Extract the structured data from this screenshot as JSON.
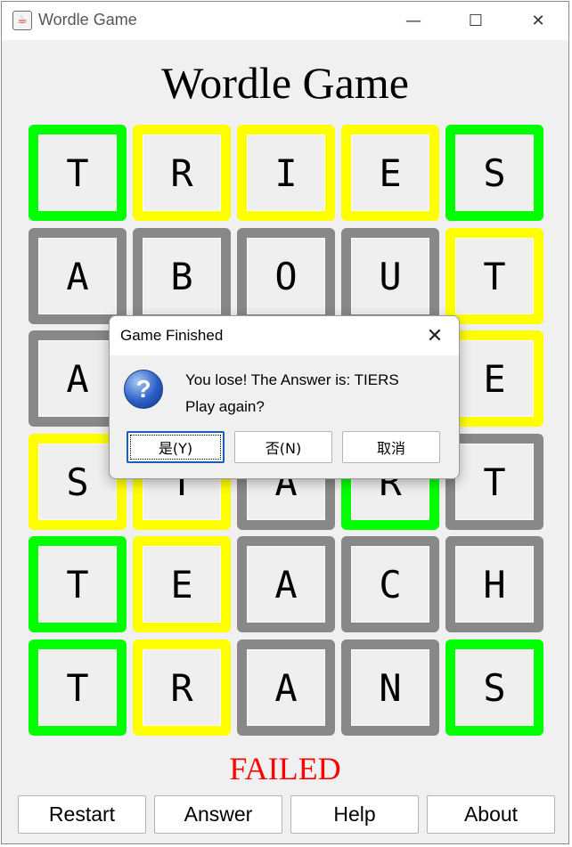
{
  "window": {
    "title": "Wordle Game",
    "controls": {
      "minimize": "—",
      "maximize": "☐",
      "close": "✕"
    }
  },
  "heading": "Wordle Game",
  "colors": {
    "green": "#00ff00",
    "yellow": "#ffff00",
    "gray": "#888888",
    "status": "#ff0000"
  },
  "rows": [
    [
      {
        "letter": "T",
        "state": "green"
      },
      {
        "letter": "R",
        "state": "yellow"
      },
      {
        "letter": "I",
        "state": "yellow"
      },
      {
        "letter": "E",
        "state": "yellow"
      },
      {
        "letter": "S",
        "state": "green"
      }
    ],
    [
      {
        "letter": "A",
        "state": "gray"
      },
      {
        "letter": "B",
        "state": "gray"
      },
      {
        "letter": "O",
        "state": "gray"
      },
      {
        "letter": "U",
        "state": "gray"
      },
      {
        "letter": "T",
        "state": "yellow"
      }
    ],
    [
      {
        "letter": "A",
        "state": "gray"
      },
      {
        "letter": "",
        "state": "gray"
      },
      {
        "letter": "",
        "state": "gray"
      },
      {
        "letter": "",
        "state": "gray"
      },
      {
        "letter": "E",
        "state": "yellow"
      }
    ],
    [
      {
        "letter": "S",
        "state": "yellow"
      },
      {
        "letter": "T",
        "state": "yellow"
      },
      {
        "letter": "A",
        "state": "gray"
      },
      {
        "letter": "R",
        "state": "green"
      },
      {
        "letter": "T",
        "state": "gray"
      }
    ],
    [
      {
        "letter": "T",
        "state": "green"
      },
      {
        "letter": "E",
        "state": "yellow"
      },
      {
        "letter": "A",
        "state": "gray"
      },
      {
        "letter": "C",
        "state": "gray"
      },
      {
        "letter": "H",
        "state": "gray"
      }
    ],
    [
      {
        "letter": "T",
        "state": "green"
      },
      {
        "letter": "R",
        "state": "yellow"
      },
      {
        "letter": "A",
        "state": "gray"
      },
      {
        "letter": "N",
        "state": "gray"
      },
      {
        "letter": "S",
        "state": "green"
      }
    ]
  ],
  "status": "FAILED",
  "buttons": {
    "restart": "Restart",
    "answer": "Answer",
    "help": "Help",
    "about": "About"
  },
  "dialog": {
    "title": "Game Finished",
    "close": "✕",
    "icon": "question-icon",
    "message_line1": "You lose! The Answer is: TIERS",
    "message_line2": "Play again?",
    "yes": "是(Y)",
    "no": "否(N)",
    "cancel": "取消"
  }
}
